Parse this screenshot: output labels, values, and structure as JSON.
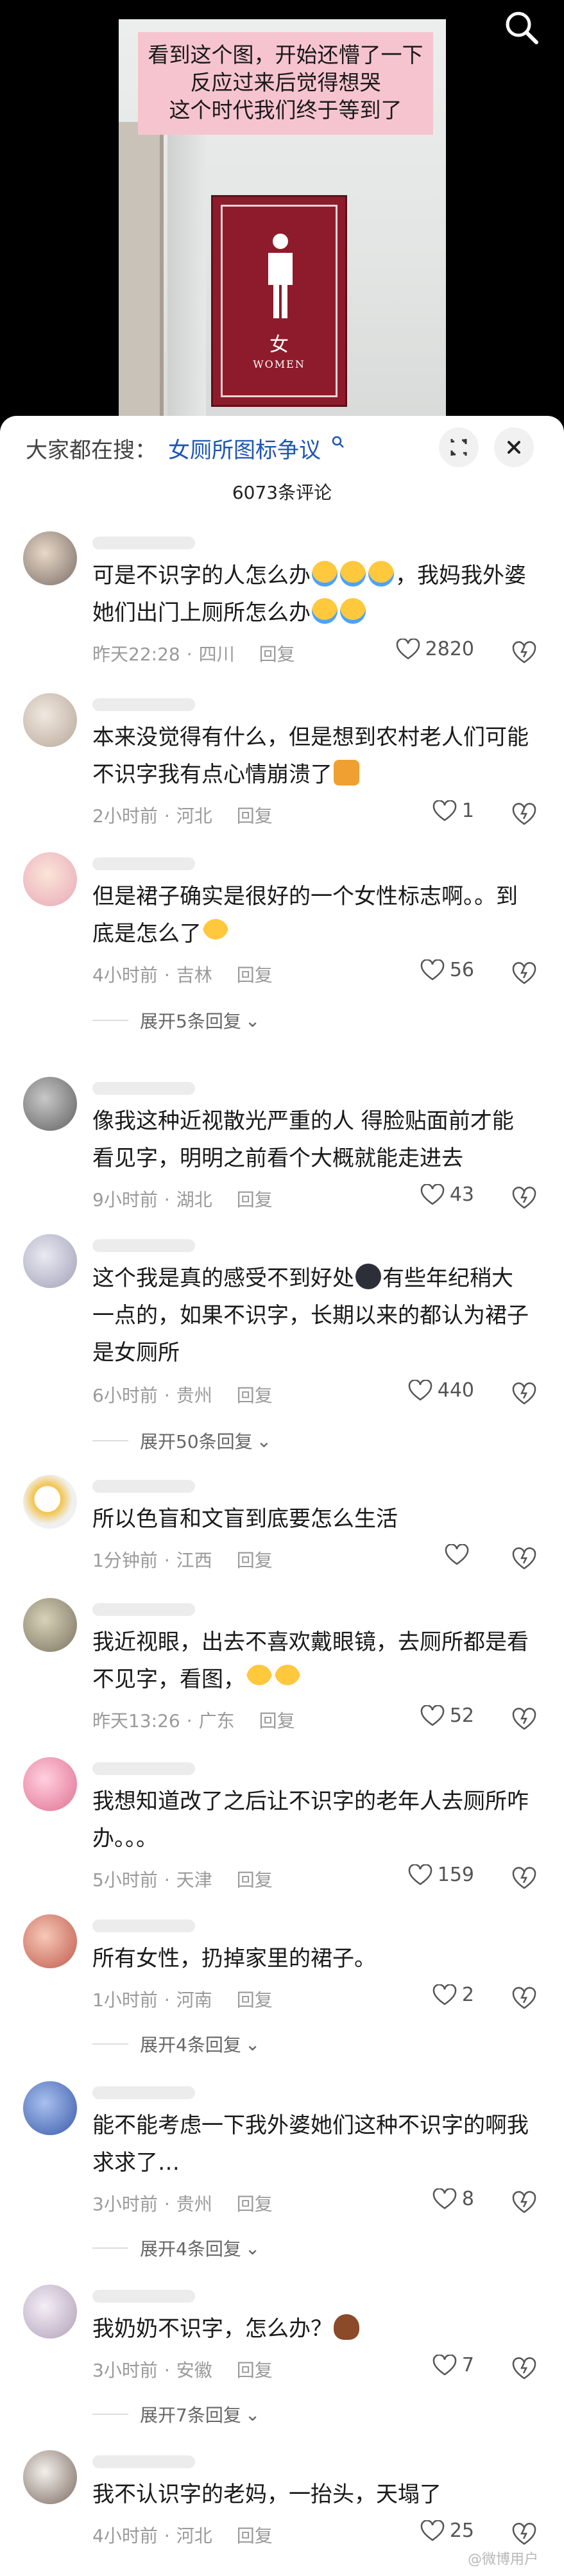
{
  "video": {
    "caption_lines": [
      "看到这个图，开始还懵了一下",
      "反应过来后觉得想哭",
      "这个时代我们终于等到了"
    ],
    "sign_text_zh": "女",
    "sign_text_en": "WOMEN"
  },
  "panel": {
    "search_label": "大家都在搜：",
    "search_keyword": "女厕所图标争议",
    "comment_count": "6073条评论"
  },
  "comments": [
    {
      "text": "可是不识字的人怎么办",
      "text2": "，我妈我外婆她们出门上厕所怎么办",
      "time": "昨天22:28",
      "loc": "四川",
      "reply": "回复",
      "likes": "2820"
    },
    {
      "text": "本来没觉得有什么，但是想到农村老人们可能不识字我有点心情崩溃了",
      "time": "2小时前",
      "loc": "河北",
      "reply": "回复",
      "likes": "1"
    },
    {
      "text": "但是裙子确实是很好的一个女性标志啊。。到底是怎么了",
      "time": "4小时前",
      "loc": "吉林",
      "reply": "回复",
      "likes": "56",
      "expand": "展开5条回复"
    },
    {
      "text": "像我这种近视散光严重的人 得脸贴面前才能看见字，明明之前看个大概就能走进去",
      "time": "9小时前",
      "loc": "湖北",
      "reply": "回复",
      "likes": "43"
    },
    {
      "text": "这个我是真的感受不到好处",
      "text2": "有些年纪稍大一点的，如果不识字，长期以来的都认为裙子是女厕所",
      "time": "6小时前",
      "loc": "贵州",
      "reply": "回复",
      "likes": "440",
      "expand": "展开50条回复"
    },
    {
      "text": "所以色盲和文盲到底要怎么生活",
      "time": "1分钟前",
      "loc": "江西",
      "reply": "回复",
      "likes": ""
    },
    {
      "text": "我近视眼，出去不喜欢戴眼镜，去厕所都是看不见字，看图，",
      "time": "昨天13:26",
      "loc": "广东",
      "reply": "回复",
      "likes": "52"
    },
    {
      "text": "我想知道改了之后让不识字的老年人去厕所咋办。。。",
      "time": "5小时前",
      "loc": "天津",
      "reply": "回复",
      "likes": "159"
    },
    {
      "text": "所有女性，扔掉家里的裙子。",
      "time": "1小时前",
      "loc": "河南",
      "reply": "回复",
      "likes": "2",
      "expand": "展开4条回复"
    },
    {
      "text": "能不能考虑一下我外婆她们这种不识字的啊我求求了…",
      "time": "3小时前",
      "loc": "贵州",
      "reply": "回复",
      "likes": "8",
      "expand": "展开4条回复"
    },
    {
      "text": "我奶奶不识字，怎么办？",
      "time": "3小时前",
      "loc": "安徽",
      "reply": "回复",
      "likes": "7",
      "expand": "展开7条回复"
    },
    {
      "text": "我不认识字的老妈，一抬头，天塌了",
      "time": "4小时前",
      "loc": "河北",
      "reply": "回复",
      "likes": "25"
    }
  ],
  "watermark": "@微博用户",
  "colors": {
    "keyword": "#1e55b5",
    "sign": "#8e1b2b",
    "caption_bg": "#f6c4cf"
  }
}
